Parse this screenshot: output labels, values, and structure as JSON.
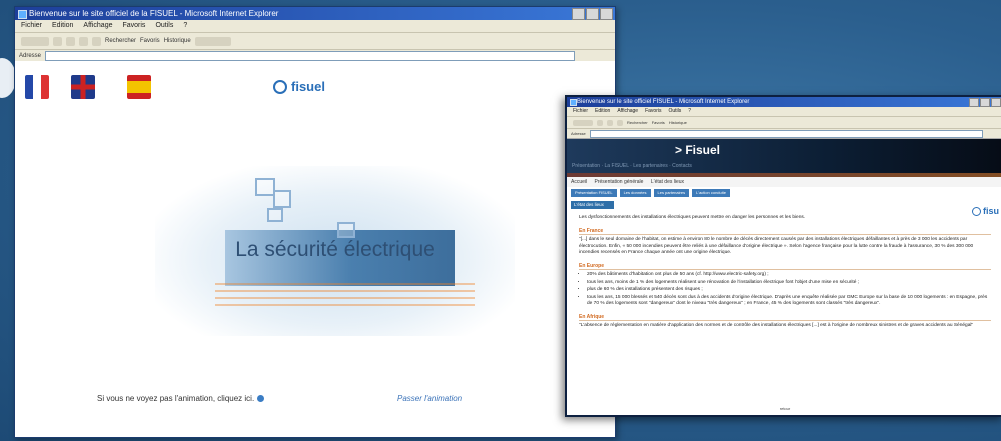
{
  "window_main": {
    "title": "Bienvenue sur le site officiel de la FISUEL - Microsoft Internet Explorer",
    "menu": [
      "Fichier",
      "Edition",
      "Affichage",
      "Favoris",
      "Outils",
      "?"
    ],
    "toolbar": {
      "search": "Rechercher",
      "favorites": "Favoris",
      "history": "Historique"
    },
    "address_label": "Adresse",
    "address_value": "",
    "logo_text": "fisuel",
    "flags": [
      "fr-flag-icon",
      "uk-flag-icon",
      "es-flag-icon"
    ],
    "hero_title": "La sécurité électrique",
    "bottom_text": "Si vous ne voyez pas l'animation, cliquez ici.",
    "skip_link": "Passer l'animation"
  },
  "window_secondary": {
    "title": "Bienvenue sur le site officiel FISUEL - Microsoft Internet Explorer",
    "menu": [
      "Fichier",
      "Edition",
      "Affichage",
      "Favoris",
      "Outils",
      "?"
    ],
    "toolbar": {
      "search": "Rechercher",
      "favorites": "Favoris",
      "history": "Historique"
    },
    "address_label": "Adresse",
    "banner_title": "> Fisuel",
    "banner_sub": "Présentation · La FISUEL · Les partenaires · Contacts",
    "breadcrumb": [
      "Accueil",
      "Présentation générale",
      "L'état des lieux"
    ],
    "tabs": [
      "Présentation FISUEL",
      "Les données",
      "Les partenaires",
      "L'action conduite"
    ],
    "logo_text": "fisu",
    "section_label": "L'état des lieux",
    "intro": "Les dysfonctionnements des installations électriques peuvent mettre en danger les personnes et les biens.",
    "heading1": "En France",
    "para1": "\"[...] dans le seul domaine de l'habitat, on estime à environ 80 le nombre de décès directement causés par des installations électriques défaillantes et à près de 3 000 les accidents par électrocution. Enfin, « 50 000 incendies peuvent être reliés à une défaillance d'origine électrique ». Selon l'agence française pour la lutte contre la fraude à l'assurance, 30 % des 300 000 incendies recensés en France chaque année ont une origine électrique.",
    "heading2": "En Europe",
    "list": [
      "20% des bâtiments d'habitation ont plus de 50 ans (cf. http://www.electric-safety.org) ;",
      "tous les ans, moins de 1 % des logements réalisent une rénovation de l'installation électrique font l'objet d'une mise en sécurité ;",
      "plus de 60 % des installations présentent des risques ;",
      "tous les ans, 15 000 blessés et 540 décès sont dus à des accidents d'origine électrique. D'après une enquête réalisée par GMC Europe sur la base de 10 000 logements : en Espagne, près de 70 % des logements sont \"dangereux\" dont le niveau \"très dangereux\" ; en France, 45 % des logements sont classés \"très dangereux\"."
    ],
    "heading3": "En Afrique",
    "para3": "\"L'absence de réglementation en matière d'application des normes et de contrôle des installations électriques [...] est à l'origine de nombreux sinistres et de graves accidents au Sénégal\"",
    "footer": "retour"
  }
}
